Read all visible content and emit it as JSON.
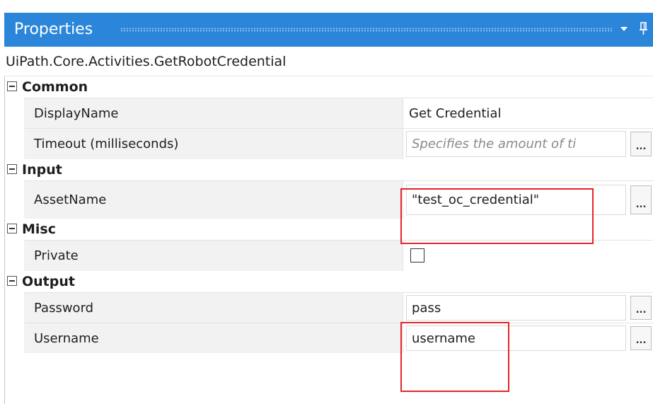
{
  "panel": {
    "title": "Properties",
    "type_name": "UiPath.Core.Activities.GetRobotCredential"
  },
  "categories": [
    {
      "label": "Common",
      "properties": [
        {
          "name": "DisplayName",
          "value": "Get Credential"
        },
        {
          "name": "Timeout (milliseconds)",
          "placeholder": "Specifies the amount of ti",
          "ellipsis": "..."
        }
      ]
    },
    {
      "label": "Input",
      "properties": [
        {
          "name": "AssetName",
          "value": "\"test_oc_credential\"",
          "ellipsis": "..."
        }
      ]
    },
    {
      "label": "Misc",
      "properties": [
        {
          "name": "Private",
          "checked": false
        }
      ]
    },
    {
      "label": "Output",
      "properties": [
        {
          "name": "Password",
          "value": "pass",
          "ellipsis": "..."
        },
        {
          "name": "Username",
          "value": "username",
          "ellipsis": "..."
        }
      ]
    }
  ],
  "colors": {
    "title_bar": "#2b86da",
    "highlight": "#e4252a",
    "name_column_bg": "#f2f2f2"
  },
  "icons": [
    "collapse-box-icon",
    "dropdown-arrow-icon",
    "pin-icon"
  ]
}
